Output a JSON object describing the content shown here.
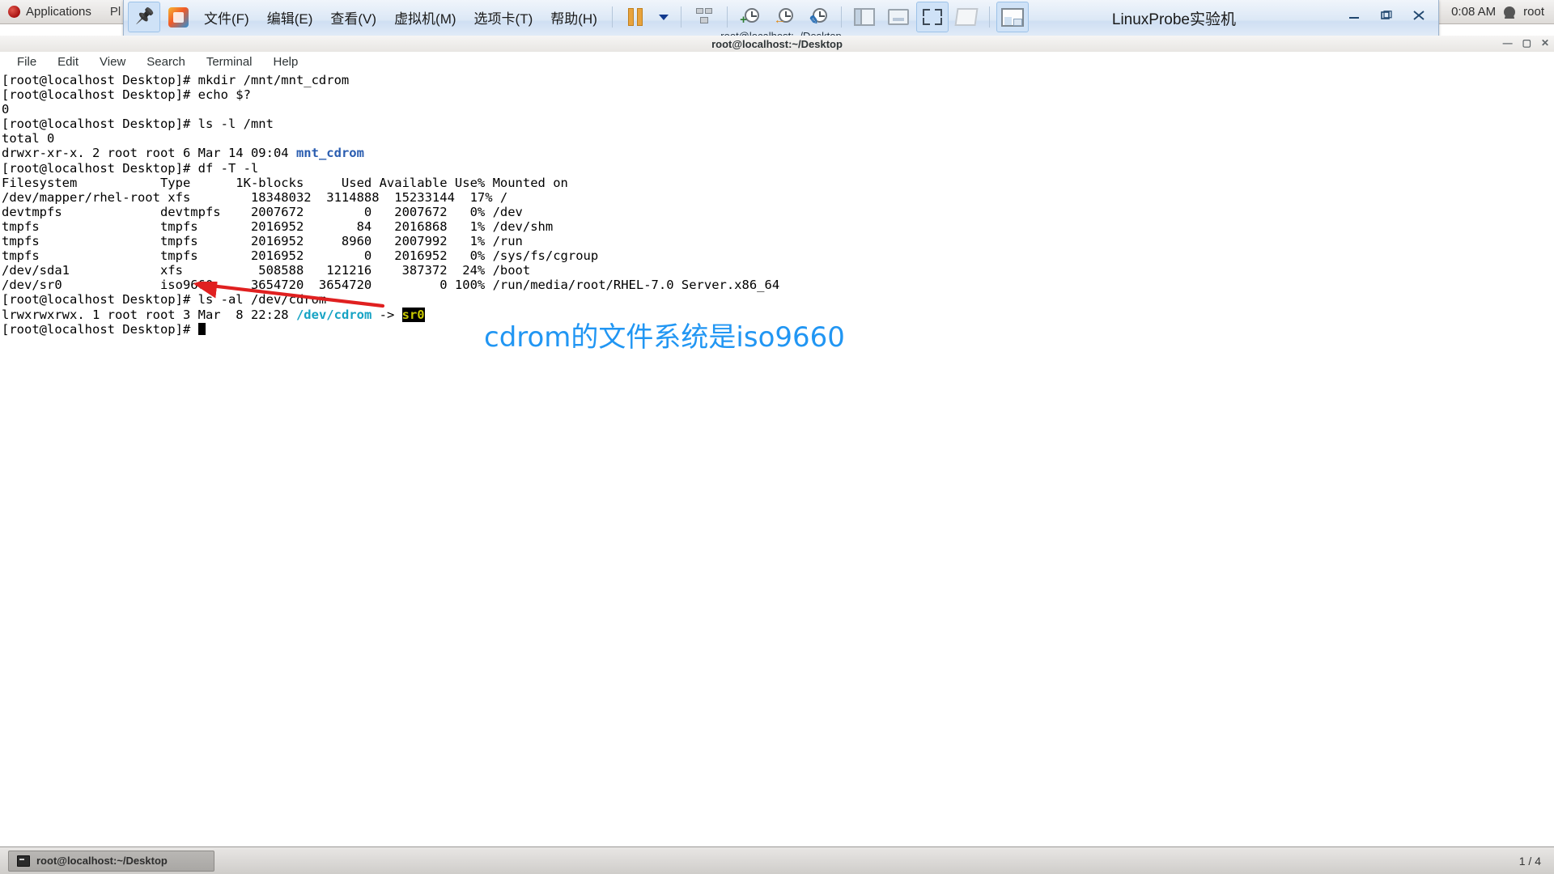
{
  "gnome_topbar": {
    "applications_label": "Applications",
    "places_label": "Pl",
    "clock": "0:08 AM",
    "user": "root",
    "logo_icon": "redhat-logo-icon",
    "user_icon": "user-icon"
  },
  "vmware": {
    "window_title": "LinuxProbe实验机",
    "inner_title": "root@localhost:~/Desktop",
    "menus": [
      {
        "label": "文件(F)",
        "name": "menu-file"
      },
      {
        "label": "编辑(E)",
        "name": "menu-edit"
      },
      {
        "label": "查看(V)",
        "name": "menu-view"
      },
      {
        "label": "虚拟机(M)",
        "name": "menu-vm"
      },
      {
        "label": "选项卡(T)",
        "name": "menu-tabs"
      },
      {
        "label": "帮助(H)",
        "name": "menu-help"
      }
    ],
    "toolbar_icons": [
      "pin-icon",
      "vmware-app-icon",
      "pause-icon",
      "dropdown-caret-icon",
      "snapshot-icon",
      "take-snapshot-icon",
      "revert-snapshot-icon",
      "snapshot-manager-icon",
      "show-library-icon",
      "show-thumbnail-bar-icon",
      "enter-fullscreen-icon",
      "unity-mode-icon",
      "console-view-icon"
    ],
    "window_controls": {
      "minimize": "minimize-icon",
      "restore": "restore-icon",
      "close": "close-icon"
    }
  },
  "terminal": {
    "title": "root@localhost:~/Desktop",
    "menus": [
      "File",
      "Edit",
      "View",
      "Search",
      "Terminal",
      "Help"
    ],
    "lines": [
      {
        "id": 1,
        "segments": [
          {
            "t": "[root@localhost Desktop]# mkdir /mnt/mnt_cdrom"
          }
        ]
      },
      {
        "id": 2,
        "segments": [
          {
            "t": "[root@localhost Desktop]# echo $?"
          }
        ]
      },
      {
        "id": 3,
        "segments": [
          {
            "t": "0"
          }
        ]
      },
      {
        "id": 4,
        "segments": [
          {
            "t": "[root@localhost Desktop]# ls -l /mnt"
          }
        ]
      },
      {
        "id": 5,
        "segments": [
          {
            "t": "total 0"
          }
        ]
      },
      {
        "id": 6,
        "segments": [
          {
            "t": "drwxr-xr-x. 2 root root 6 Mar 14 09:04 "
          },
          {
            "t": "mnt_cdrom",
            "c": "c-blue"
          }
        ]
      },
      {
        "id": 7,
        "segments": [
          {
            "t": "[root@localhost Desktop]# df -T -l"
          }
        ]
      },
      {
        "id": 8,
        "segments": [
          {
            "t": "Filesystem           Type      1K-blocks     Used Available Use% Mounted on"
          }
        ]
      },
      {
        "id": 9,
        "segments": [
          {
            "t": "/dev/mapper/rhel-root xfs        18348032  3114888  15233144  17% /"
          }
        ]
      },
      {
        "id": 10,
        "segments": [
          {
            "t": "devtmpfs             devtmpfs    2007672        0   2007672   0% /dev"
          }
        ]
      },
      {
        "id": 11,
        "segments": [
          {
            "t": "tmpfs                tmpfs       2016952       84   2016868   1% /dev/shm"
          }
        ]
      },
      {
        "id": 12,
        "segments": [
          {
            "t": "tmpfs                tmpfs       2016952     8960   2007992   1% /run"
          }
        ]
      },
      {
        "id": 13,
        "segments": [
          {
            "t": "tmpfs                tmpfs       2016952        0   2016952   0% /sys/fs/cgroup"
          }
        ]
      },
      {
        "id": 14,
        "segments": [
          {
            "t": "/dev/sda1            xfs          508588   121216    387372  24% /boot"
          }
        ]
      },
      {
        "id": 15,
        "segments": [
          {
            "t": "/dev/sr0             iso9660     3654720  3654720         0 100% /run/media/root/RHEL-7.0 Server.x86_64"
          }
        ]
      },
      {
        "id": 16,
        "segments": [
          {
            "t": "[root@localhost Desktop]# ls -al /dev/cdrom"
          }
        ]
      },
      {
        "id": 17,
        "segments": [
          {
            "t": "lrwxrwxrwx. 1 root root 3 Mar  8 22:28 "
          },
          {
            "t": "/dev/cdrom",
            "c": "c-cyan"
          },
          {
            "t": " -> "
          },
          {
            "t": "sr0",
            "c": "c-hl"
          }
        ]
      },
      {
        "id": 18,
        "segments": [
          {
            "t": "[root@localhost Desktop]# "
          },
          {
            "t": "",
            "cursor": true
          }
        ]
      }
    ]
  },
  "df_table": {
    "columns": [
      "Filesystem",
      "Type",
      "1K-blocks",
      "Used",
      "Available",
      "Use%",
      "Mounted on"
    ],
    "rows": [
      [
        "/dev/mapper/rhel-root",
        "xfs",
        "18348032",
        "3114888",
        "15233144",
        "17%",
        "/"
      ],
      [
        "devtmpfs",
        "devtmpfs",
        "2007672",
        "0",
        "2007672",
        "0%",
        "/dev"
      ],
      [
        "tmpfs",
        "tmpfs",
        "2016952",
        "84",
        "2016868",
        "1%",
        "/dev/shm"
      ],
      [
        "tmpfs",
        "tmpfs",
        "2016952",
        "8960",
        "2007992",
        "1%",
        "/run"
      ],
      [
        "tmpfs",
        "tmpfs",
        "2016952",
        "0",
        "2016952",
        "0%",
        "/sys/fs/cgroup"
      ],
      [
        "/dev/sda1",
        "xfs",
        "508588",
        "121216",
        "387372",
        "24%",
        "/boot"
      ],
      [
        "/dev/sr0",
        "iso9660",
        "3654720",
        "3654720",
        "0",
        "100%",
        "/run/media/root/RHEL-7.0 Server.x86_64"
      ]
    ]
  },
  "annotation": {
    "text": "cdrom的文件系统是iso9660",
    "text_color": "#2196f3",
    "arrow_color": "#e02020",
    "arrow_points_to": "iso9660"
  },
  "taskbar": {
    "window_button": "root@localhost:~/Desktop",
    "pager": "1 / 4",
    "icon": "terminal-icon"
  }
}
